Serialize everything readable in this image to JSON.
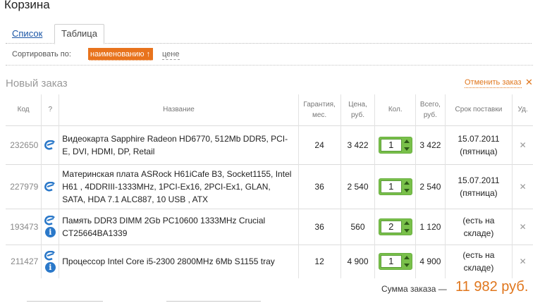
{
  "page": {
    "title": "Корзина"
  },
  "tabs": [
    {
      "label": "Список",
      "active": false
    },
    {
      "label": "Таблица",
      "active": true
    }
  ],
  "sort": {
    "label": "Сортировать по:",
    "active_option": "наименованию ↑",
    "other_option": "цене",
    "accent_color": "#e8731d"
  },
  "order": {
    "title": "Новый заказ",
    "cancel_label": "Отменить заказ",
    "cancel_icon": "close-icon"
  },
  "table": {
    "headers": {
      "code": "Код",
      "q": "?",
      "name": "Название",
      "warranty_1": "Гарантия,",
      "warranty_2": "мес.",
      "price_1": "Цена,",
      "price_2": "руб.",
      "qty": "Кол.",
      "total_1": "Всего,",
      "total_2": "руб.",
      "delivery": "Срок поставки",
      "del": "Уд."
    },
    "rows": [
      {
        "code": "232650",
        "icons": [
          "e-icon"
        ],
        "name": "Видеокарта Sapphire Radeon HD6770, 512Mb DDR5, PCI-E, DVI, HDMI, DP, Retail",
        "warranty": "24",
        "price": "3 422",
        "qty": "1",
        "total": "3 422",
        "delivery_1": "15.07.2011",
        "delivery_2": "(пятница)"
      },
      {
        "code": "227979",
        "icons": [
          "e-icon"
        ],
        "name": "Материнская плата ASRock H61iCafe B3, Socket1155, Intel H61 , 4DDRIII-1333MHz, 1PCI-Ex16, 2PCI-Ex1, GLAN, SATA, HDA 7.1 ALC887, 10 USB , ATX",
        "warranty": "36",
        "price": "2 540",
        "qty": "1",
        "total": "2 540",
        "delivery_1": "15.07.2011",
        "delivery_2": "(пятница)"
      },
      {
        "code": "193473",
        "icons": [
          "e-icon",
          "info-icon"
        ],
        "name": "Память DDR3 DIMM 2Gb PC10600 1333MHz Crucial CT25664BA1339",
        "warranty": "36",
        "price": "560",
        "qty": "2",
        "total": "1 120",
        "delivery_1": "(есть на",
        "delivery_2": "складе)"
      },
      {
        "code": "211427",
        "icons": [
          "e-icon",
          "info-icon"
        ],
        "name": "Процессор Intel Core i5-2300 2800MHz 6Mb S1155 tray",
        "warranty": "12",
        "price": "4 900",
        "qty": "1",
        "total": "4 900",
        "delivery_1": "(есть на",
        "delivery_2": "складе)"
      }
    ]
  },
  "summary": {
    "label": "Сумма заказа —",
    "value": "11 982 руб.",
    "value_color": "#e0761c"
  },
  "icons": {
    "e": "e-icon",
    "info": "info-icon",
    "info_glyph": "i",
    "delete": "delete-icon",
    "delete_glyph": "✕",
    "close_glyph": "✕"
  }
}
